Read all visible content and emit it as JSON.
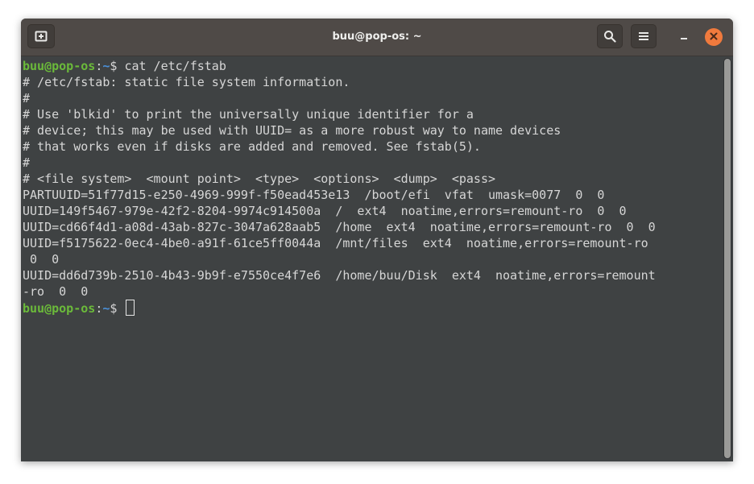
{
  "window": {
    "title": "buu@pop-os: ~"
  },
  "icons": {
    "new_tab": "new-tab-icon",
    "search": "search-icon",
    "menu": "hamburger-menu-icon",
    "minimize": "minimize-icon",
    "close": "close-icon"
  },
  "colors": {
    "titlebar": "#4f4a47",
    "terminal_bg": "#3f4243",
    "text": "#d6d6d6",
    "prompt_user": "#6bba3a",
    "prompt_path": "#4a90d9",
    "close_button": "#f07a3d"
  },
  "terminal": {
    "prompt": {
      "user_host": "buu@pop-os",
      "colon": ":",
      "path": "~",
      "dollar": "$ "
    },
    "command": "cat /etc/fstab",
    "output": [
      "# /etc/fstab: static file system information.",
      "#",
      "# Use 'blkid' to print the universally unique identifier for a",
      "# device; this may be used with UUID= as a more robust way to name devices",
      "# that works even if disks are added and removed. See fstab(5).",
      "#",
      "# <file system>  <mount point>  <type>  <options>  <dump>  <pass>",
      "PARTUUID=51f77d15-e250-4969-999f-f50ead453e13  /boot/efi  vfat  umask=0077  0  0",
      "UUID=149f5467-979e-42f2-8204-9974c914500a  /  ext4  noatime,errors=remount-ro  0  0",
      "UUID=cd66f4d1-a08d-43ab-827c-3047a628aab5  /home  ext4  noatime,errors=remount-ro  0  0",
      "UUID=f5175622-0ec4-4be0-a91f-61ce5ff0044a  /mnt/files  ext4  noatime,errors=remount-ro",
      " 0  0",
      "UUID=dd6d739b-2510-4b43-9b9f-e7550ce4f7e6  /home/buu/Disk  ext4  noatime,errors=remount",
      "-ro  0  0"
    ]
  }
}
